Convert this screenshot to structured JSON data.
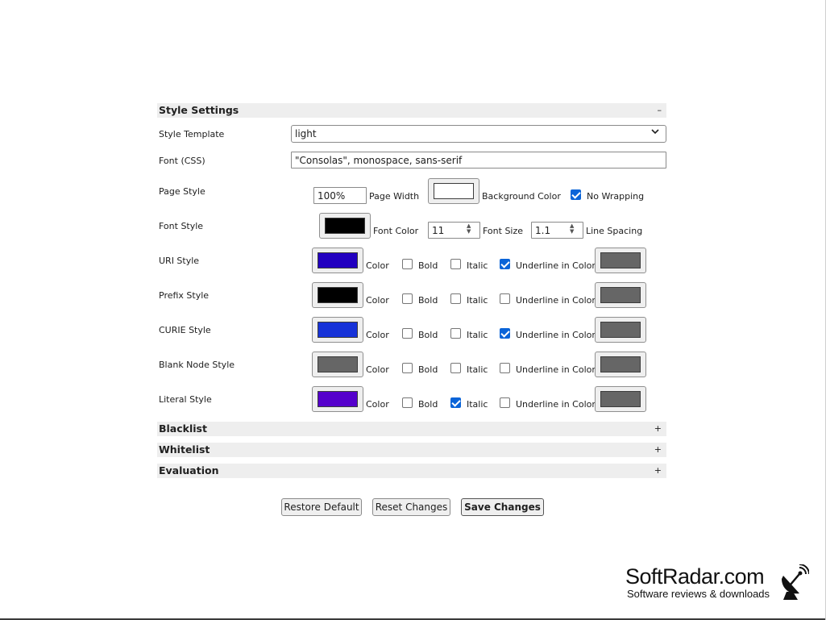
{
  "style_settings": {
    "title": "Style Settings",
    "toggle": "–",
    "style_template": {
      "label": "Style Template",
      "value": "light"
    },
    "font_css": {
      "label": "Font (CSS)",
      "value": "\"Consolas\", monospace, sans-serif"
    },
    "page_style": {
      "label": "Page Style",
      "page_width": "100%",
      "page_width_label": "Page Width",
      "background_color": "#ffffff",
      "background_color_label": "Background Color",
      "no_wrapping_label": "No Wrapping",
      "no_wrapping": true
    },
    "font_style": {
      "label": "Font Style",
      "font_color": "#000000",
      "font_color_label": "Font Color",
      "font_size": "11",
      "font_size_label": "Font Size",
      "line_spacing": "1.1",
      "line_spacing_label": "Line Spacing"
    },
    "option_labels": {
      "color": "Color",
      "bold": "Bold",
      "italic": "Italic",
      "underline": "Underline in Color"
    },
    "styles": [
      {
        "label": "URI Style",
        "color": "#2200c0",
        "bold": false,
        "italic": false,
        "underline": true,
        "underline_color": "#666666"
      },
      {
        "label": "Prefix Style",
        "color": "#000000",
        "bold": false,
        "italic": false,
        "underline": false,
        "underline_color": "#666666"
      },
      {
        "label": "CURIE Style",
        "color": "#1632d8",
        "bold": false,
        "italic": false,
        "underline": true,
        "underline_color": "#666666"
      },
      {
        "label": "Blank Node Style",
        "color": "#666666",
        "bold": false,
        "italic": false,
        "underline": false,
        "underline_color": "#666666"
      },
      {
        "label": "Literal Style",
        "color": "#5500cc",
        "bold": false,
        "italic": true,
        "underline": false,
        "underline_color": "#666666"
      }
    ]
  },
  "collapsed_sections": [
    {
      "title": "Blacklist",
      "toggle": "+"
    },
    {
      "title": "Whitelist",
      "toggle": "+"
    },
    {
      "title": "Evaluation",
      "toggle": "+"
    }
  ],
  "buttons": {
    "restore": "Restore Default",
    "reset": "Reset Changes",
    "save": "Save Changes"
  },
  "watermark": {
    "brand": "SoftRadar.com",
    "tagline": "Software reviews & downloads",
    "icon": "satellite-dish-icon"
  }
}
